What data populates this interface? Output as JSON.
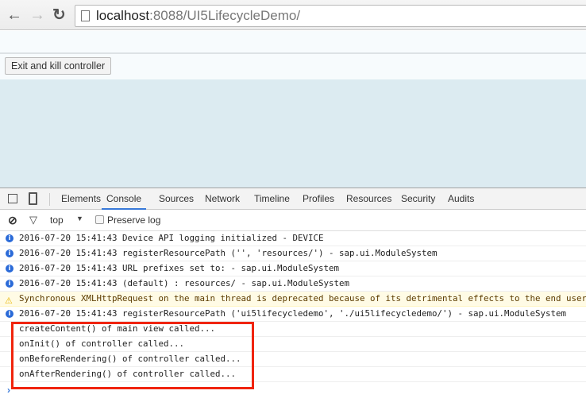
{
  "browser": {
    "back_icon": "arrow-left-icon",
    "forward_icon": "arrow-right-icon",
    "reload_icon": "reload-icon",
    "url_host": "localhost",
    "url_rest": ":8088/UI5LifecycleDemo/"
  },
  "page": {
    "button_label": "Exit and kill controller"
  },
  "devtools": {
    "tabs": [
      "Elements",
      "Console",
      "Sources",
      "Network",
      "Timeline",
      "Profiles",
      "Resources",
      "Security",
      "Audits"
    ],
    "active_tab": "Console",
    "context": "top",
    "preserve_log_label": "Preserve log",
    "preserve_log_checked": false,
    "logs": [
      {
        "level": "info",
        "text": "2016-07-20 15:41:43 Device API logging initialized - DEVICE"
      },
      {
        "level": "info",
        "text": "2016-07-20 15:41:43 registerResourcePath ('', 'resources/') -  sap.ui.ModuleSystem"
      },
      {
        "level": "info",
        "text": "2016-07-20 15:41:43 URL prefixes set to: -  sap.ui.ModuleSystem"
      },
      {
        "level": "info",
        "text": "2016-07-20 15:41:43   (default) : resources/ -  sap.ui.ModuleSystem"
      },
      {
        "level": "warning",
        "text": "Synchronous XMLHttpRequest on the main thread is deprecated because of its detrimental effects to the end user's experience."
      },
      {
        "level": "info",
        "text": "2016-07-20 15:41:43 registerResourcePath ('ui5lifecycledemo', './ui5lifecycledemo/') -  sap.ui.ModuleSystem"
      },
      {
        "level": "log",
        "text": "createContent() of main view called..."
      },
      {
        "level": "log",
        "text": "onInit() of controller called..."
      },
      {
        "level": "log",
        "text": "onBeforeRendering() of controller called..."
      },
      {
        "level": "log",
        "text": "onAfterRendering() of controller called..."
      }
    ],
    "highlight_color": "#f0240c"
  }
}
